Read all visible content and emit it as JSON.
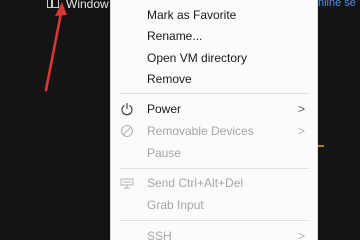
{
  "background": {
    "window_name": "Window",
    "link_text": "nline se"
  },
  "menu": {
    "items": [
      {
        "label": "Mark as Favorite"
      },
      {
        "label": "Rename..."
      },
      {
        "label": "Open VM directory"
      },
      {
        "label": "Remove"
      },
      {
        "label": "Power",
        "icon": "power-icon",
        "submenu": ">"
      },
      {
        "label": "Removable Devices",
        "icon": "removable-devices-icon",
        "submenu": ">",
        "disabled": true
      },
      {
        "label": "Pause",
        "disabled": true
      },
      {
        "label": "Send Ctrl+Alt+Del",
        "icon": "keyboard-icon",
        "disabled": true
      },
      {
        "label": "Grab Input",
        "disabled": true
      },
      {
        "label": "SSH",
        "submenu": ">",
        "disabled": true
      }
    ]
  },
  "colors": {
    "menu_bg": "#fbfbfb",
    "text": "#1a1a1a",
    "disabled_text": "#a6a6a6",
    "annotation_arrow": "#d93636",
    "link": "#4a8fe3"
  }
}
